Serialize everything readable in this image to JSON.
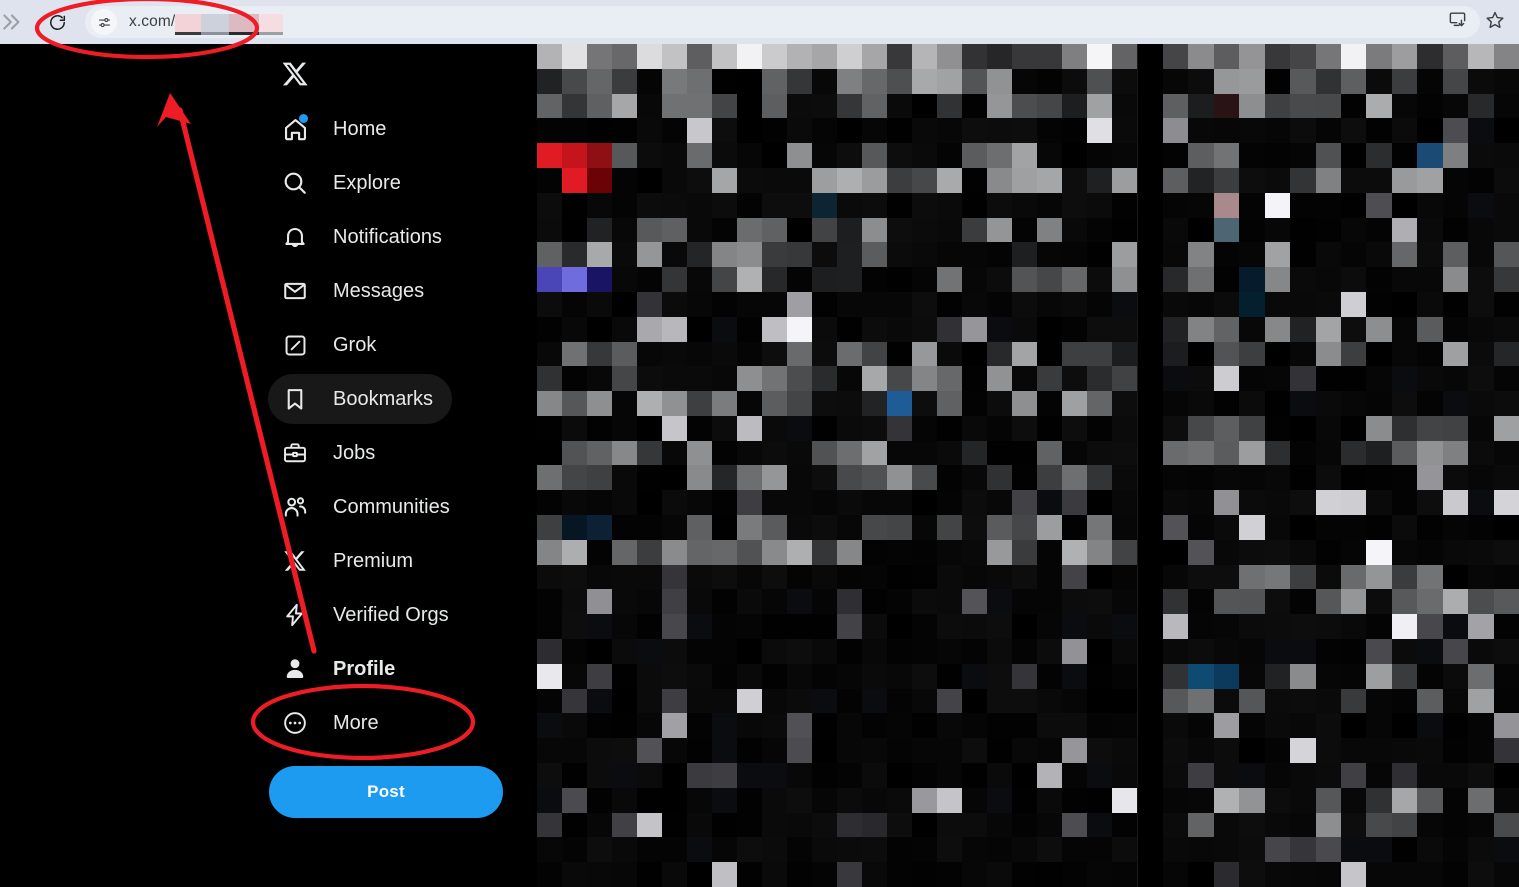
{
  "browser": {
    "url_prefix": "x.com/",
    "url_redacted": true,
    "forward_icon": "forward-arrow-icon",
    "reload_icon": "reload-icon",
    "site_info_icon": "site-settings-icon",
    "install_icon": "install-app-icon",
    "bookmark_icon": "bookmark-star-icon",
    "chrome_bg": "#dee3ed",
    "omnibox_bg": "#e9edf4",
    "url_text_color": "#3c4043"
  },
  "app": {
    "brand_icon": "x-logo-icon",
    "accent_color": "#1d9bf0",
    "text_color": "#e7e9ea",
    "background": "#000000",
    "hover_pill": "#181818"
  },
  "sidebar": {
    "items": [
      {
        "label": "Home",
        "icon": "home-icon",
        "badge": true,
        "state": "default"
      },
      {
        "label": "Explore",
        "icon": "search-icon",
        "badge": false,
        "state": "default"
      },
      {
        "label": "Notifications",
        "icon": "bell-icon",
        "badge": false,
        "state": "default"
      },
      {
        "label": "Messages",
        "icon": "envelope-icon",
        "badge": false,
        "state": "default"
      },
      {
        "label": "Grok",
        "icon": "grok-icon",
        "badge": false,
        "state": "default"
      },
      {
        "label": "Bookmarks",
        "icon": "bookmark-icon",
        "badge": false,
        "state": "hovered"
      },
      {
        "label": "Jobs",
        "icon": "briefcase-icon",
        "badge": false,
        "state": "default"
      },
      {
        "label": "Communities",
        "icon": "communities-icon",
        "badge": false,
        "state": "default"
      },
      {
        "label": "Premium",
        "icon": "x-premium-icon",
        "badge": false,
        "state": "default"
      },
      {
        "label": "Verified Orgs",
        "icon": "lightning-icon",
        "badge": false,
        "state": "default"
      },
      {
        "label": "Profile",
        "icon": "person-filled-icon",
        "badge": false,
        "state": "current"
      },
      {
        "label": "More",
        "icon": "more-circle-icon",
        "badge": false,
        "state": "default"
      }
    ],
    "post_button_label": "Post"
  },
  "annotations": {
    "color": "#ee1c25",
    "items": [
      {
        "type": "ellipse",
        "target": "address-bar",
        "name": "annotation-ellipse-url"
      },
      {
        "type": "ellipse",
        "target": "sidebar-profile",
        "name": "annotation-ellipse-profile"
      },
      {
        "type": "arrow",
        "from": "sidebar-profile-area",
        "to": "address-bar",
        "name": "annotation-arrow"
      }
    ]
  },
  "content": {
    "state": "pixelated-redacted",
    "description": "Timeline and right column are mosaic-censored",
    "bottom_text": ""
  }
}
